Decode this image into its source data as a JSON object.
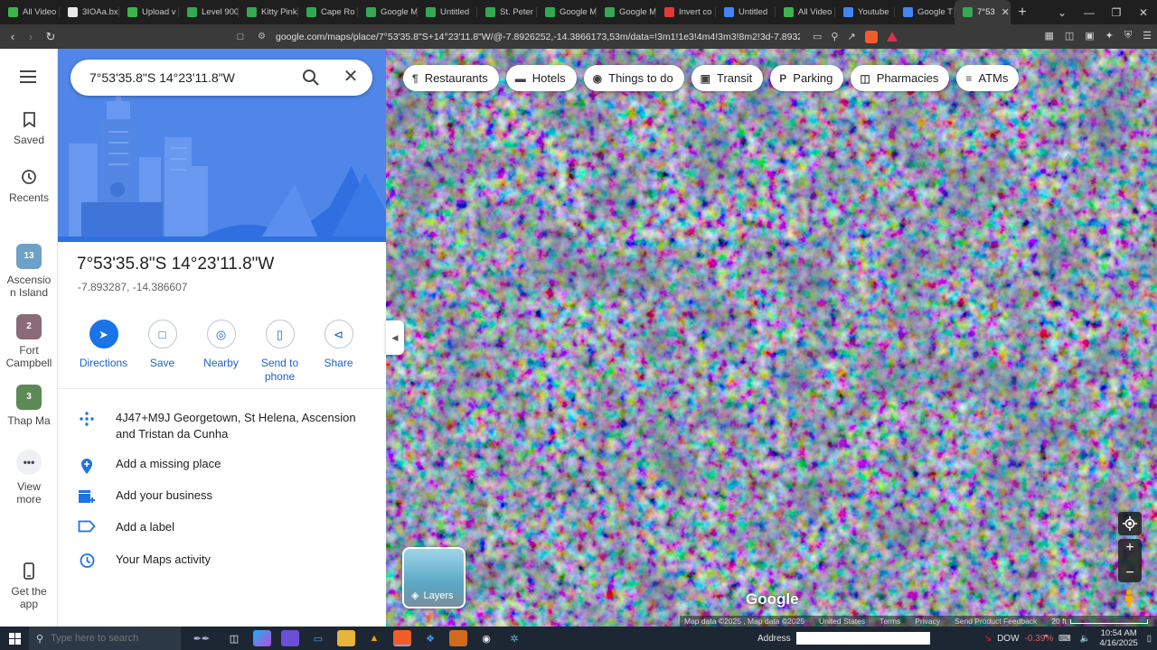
{
  "browser": {
    "tabs": [
      {
        "label": "All Video",
        "color": "#3bb54a"
      },
      {
        "label": "3IOAa.bx",
        "color": "#e9e9e9"
      },
      {
        "label": "Upload v",
        "color": "#3bb54a"
      },
      {
        "label": "Level 900",
        "color": "#34a853"
      },
      {
        "label": "Kitty Pink",
        "color": "#34a853"
      },
      {
        "label": "Cape Ro",
        "color": "#34a853"
      },
      {
        "label": "Google M",
        "color": "#34a853"
      },
      {
        "label": "Untitled",
        "color": "#34a853"
      },
      {
        "label": "St. Peter",
        "color": "#34a853"
      },
      {
        "label": "Google M",
        "color": "#34a853"
      },
      {
        "label": "Google M",
        "color": "#34a853"
      },
      {
        "label": "Invert co",
        "color": "#e53935"
      },
      {
        "label": "Untitled",
        "color": "#4285f4"
      },
      {
        "label": "All Video",
        "color": "#3bb54a"
      },
      {
        "label": "Youtube",
        "color": "#4285f4"
      },
      {
        "label": "Google T",
        "color": "#4285f4"
      }
    ],
    "active_tab": {
      "label": "7°53",
      "color": "#34a853"
    },
    "url": "google.com/maps/place/7°53'35.8\"S+14°23'11.8\"W/@-7.8926252,-14.3866173,53m/data=!3m1!1e3!4m4!3m3!8m2!3d-7.893287!4d-14.38..."
  },
  "rail": {
    "saved": "Saved",
    "recents": "Recents",
    "recent_items": [
      {
        "label": "Ascensio n Island",
        "badge": "13",
        "color": "#6fa0c8"
      },
      {
        "label": "Fort Campbell",
        "badge": "2",
        "color": "#8a6b78"
      },
      {
        "label": "Thap Ma",
        "badge": "3",
        "color": "#5c8a55"
      }
    ],
    "view_more": "View more",
    "get_app": "Get the app"
  },
  "search": {
    "value": "7°53'35.8\"S 14°23'11.8\"W"
  },
  "place": {
    "title": "7°53'35.8\"S 14°23'11.8\"W",
    "coords": "-7.893287, -14.386607",
    "actions": [
      {
        "label": "Directions",
        "icon": "directions-icon"
      },
      {
        "label": "Save",
        "icon": "bookmark-icon"
      },
      {
        "label": "Nearby",
        "icon": "nearby-icon"
      },
      {
        "label": "Send to phone",
        "icon": "send-to-phone-icon"
      },
      {
        "label": "Share",
        "icon": "share-icon"
      }
    ],
    "plus_code": "4J47+M9J Georgetown, St Helena, Ascension and Tristan da Cunha",
    "add_missing_place": "Add a missing place",
    "add_business": "Add your business",
    "add_label": "Add a label",
    "maps_activity": "Your Maps activity"
  },
  "map": {
    "chips": [
      {
        "label": "Restaurants",
        "icon": "fork-knife-icon"
      },
      {
        "label": "Hotels",
        "icon": "bed-icon"
      },
      {
        "label": "Things to do",
        "icon": "camera-icon"
      },
      {
        "label": "Transit",
        "icon": "train-icon"
      },
      {
        "label": "Parking",
        "icon": "parking-icon"
      },
      {
        "label": "Pharmacies",
        "icon": "pharmacy-icon"
      },
      {
        "label": "ATMs",
        "icon": "atm-icon"
      }
    ],
    "layers_label": "Layers",
    "watermark": "Google",
    "footer": {
      "map_data": "Map data ©2025 , Map data ©2025",
      "region": "United States",
      "terms": "Terms",
      "privacy": "Privacy",
      "feedback": "Send Product Feedback",
      "scale": "20 ft"
    }
  },
  "taskbar": {
    "search_placeholder": "Type here to search",
    "address_label": "Address",
    "ticker": "DOW",
    "ticker_change": "-0.39%",
    "time": "10:54 AM",
    "date": "4/16/2025"
  }
}
